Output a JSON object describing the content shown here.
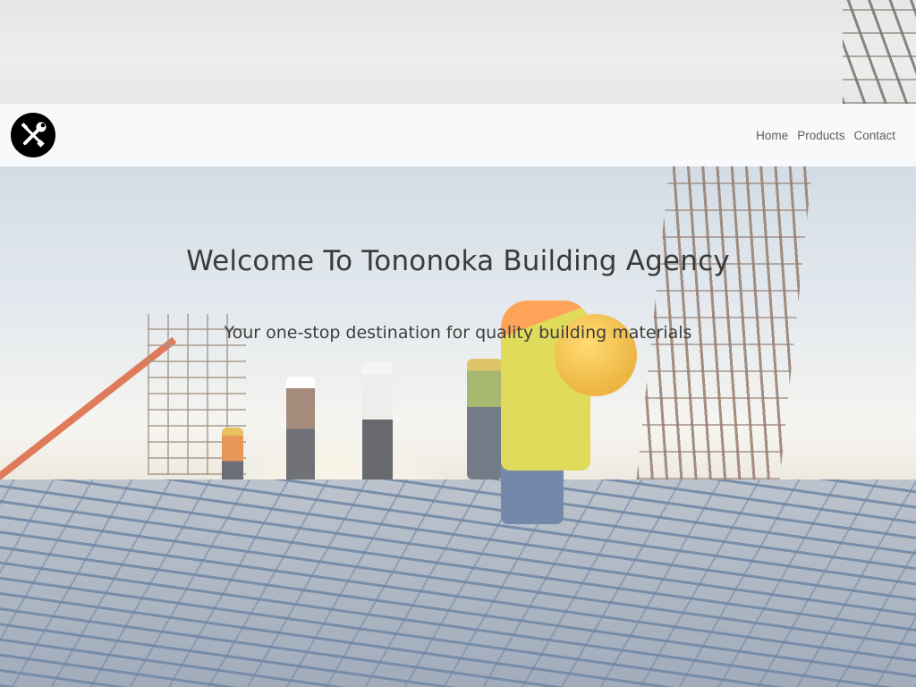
{
  "navbar": {
    "logo_icon": "tools-icon",
    "links": [
      {
        "label": "Home"
      },
      {
        "label": "Products"
      },
      {
        "label": "Contact"
      }
    ]
  },
  "hero": {
    "title": "Welcome To Tononoka Building Agency",
    "subtitle": "Your one-stop destination for quality building materials"
  },
  "colors": {
    "navbar_bg": "#f8f9fa",
    "nav_link": "#5a5d61",
    "logo_bg": "#000000",
    "heading": "#3a3a3a"
  }
}
